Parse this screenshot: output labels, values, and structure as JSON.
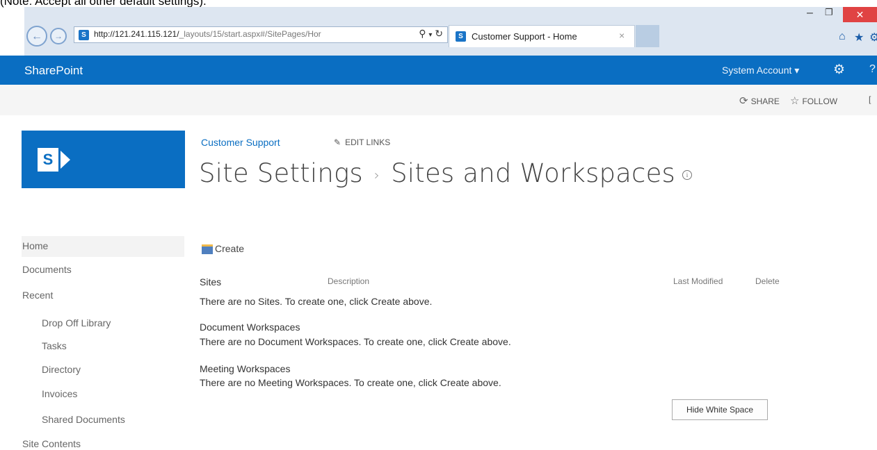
{
  "note": "(Note: Accept all other default settings).",
  "browser": {
    "url_host": "http://121.241.115.121/",
    "url_path": "_layouts/15/start.aspx#/SitePages/Hor",
    "tab_title": "Customer Support - Home"
  },
  "suite_bar": {
    "brand": "SharePoint",
    "account": "System Account ▾"
  },
  "ribbon": {
    "share": "SHARE",
    "follow": "FOLLOW"
  },
  "header": {
    "site_link": "Customer Support",
    "edit_links": "EDIT LINKS",
    "title_part1": "Site Settings",
    "title_part2": "Sites and Workspaces"
  },
  "left_nav": {
    "items": [
      {
        "label": "Home"
      },
      {
        "label": "Documents"
      },
      {
        "label": "Recent"
      },
      {
        "label": "Drop Off Library"
      },
      {
        "label": "Tasks"
      },
      {
        "label": "Directory"
      },
      {
        "label": "Invoices"
      },
      {
        "label": "Shared Documents"
      },
      {
        "label": "Site Contents"
      }
    ]
  },
  "main": {
    "create_label": "Create",
    "columns": {
      "sites": "Sites",
      "description": "Description",
      "last_modified": "Last Modified",
      "delete": "Delete"
    },
    "sites_empty": "There are no Sites. To create one, click Create above.",
    "doc_ws_heading": "Document Workspaces",
    "doc_ws_empty": "There are no Document Workspaces. To create one, click Create above.",
    "meeting_ws_heading": "Meeting Workspaces",
    "meeting_ws_empty": "There are no Meeting Workspaces. To create one, click Create above.",
    "hide_whitespace": "Hide White Space"
  },
  "colors": {
    "suite_bar": "#0a6ec2",
    "link": "#0a6ec2",
    "close_button": "#e04343"
  }
}
